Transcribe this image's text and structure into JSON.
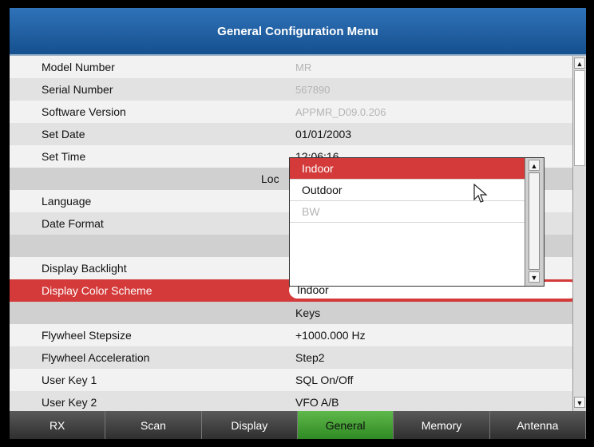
{
  "title": "General Configuration Menu",
  "rows": [
    {
      "label": "Model Number",
      "value": "MR"
    },
    {
      "label": "Serial Number",
      "value": "567890"
    },
    {
      "label": "Software Version",
      "value": "APPMR_D09.0.206"
    },
    {
      "label": "Set Date",
      "value": "01/01/2003"
    },
    {
      "label": "Set Time",
      "value": "12:06:16"
    },
    {
      "section": "Loc"
    },
    {
      "label": "Language"
    },
    {
      "label": "Date Format"
    },
    {
      "section": ""
    },
    {
      "label": "Display Backlight"
    },
    {
      "label": "Display Color Scheme",
      "value": "Indoor"
    },
    {
      "section": "Keys"
    },
    {
      "label": "Flywheel Stepsize",
      "value": "+1000.000 Hz"
    },
    {
      "label": "Flywheel Acceleration",
      "value": "Step2"
    },
    {
      "label": "User Key 1",
      "value": "SQL On/Off"
    },
    {
      "label": "User Key 2",
      "value": "VFO A/B"
    }
  ],
  "dropdown": {
    "options": [
      "Indoor",
      "Outdoor",
      "BW"
    ],
    "highlighted": "Indoor",
    "disabled": [
      "BW"
    ]
  },
  "scroll_arrows": {
    "up": "▲",
    "down": "▼"
  },
  "tabs": [
    "RX",
    "Scan",
    "Display",
    "General",
    "Memory",
    "Antenna"
  ],
  "active_tab": "General",
  "colors": {
    "title_bar": "#1f5fa4",
    "selection": "#d43a3a",
    "active_tab": "#3f9e32"
  }
}
